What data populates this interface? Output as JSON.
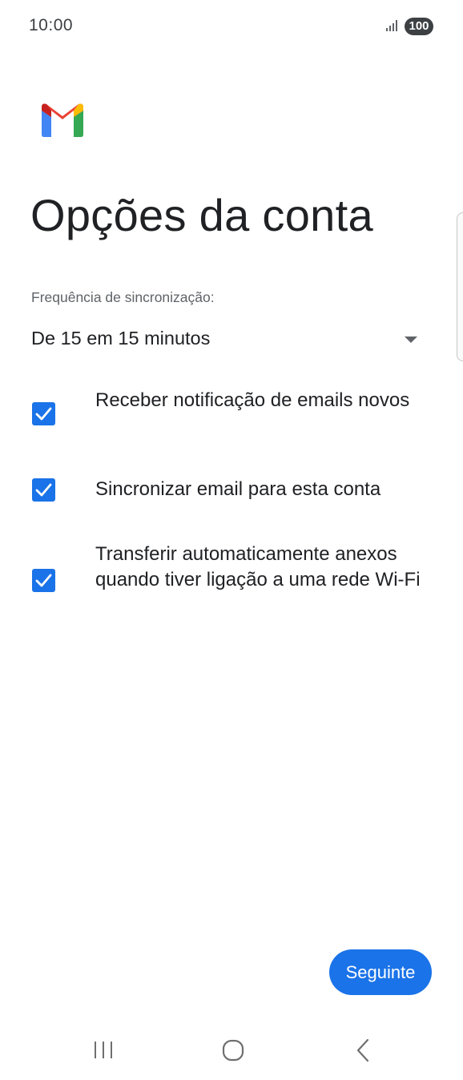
{
  "status_bar": {
    "time": "10:00",
    "signal_icon": "signal-bars-icon",
    "battery": "100"
  },
  "header": {
    "logo_icon": "gmail-logo-icon",
    "title": "Opções da conta"
  },
  "sync": {
    "label": "Frequência de sincronização:",
    "selected": "De 15 em 15 minutos",
    "dropdown_icon": "dropdown-arrow-icon"
  },
  "options": [
    {
      "label": "Receber notificação de emails novos",
      "checked": true
    },
    {
      "label": "Sincronizar email para esta conta",
      "checked": true
    },
    {
      "label": "Transferir automaticamente anexos quando tiver ligação a uma rede Wi-Fi",
      "checked": true
    }
  ],
  "actions": {
    "next_label": "Seguinte"
  },
  "nav_bar": {
    "items": [
      "recent-apps-icon",
      "home-icon",
      "back-icon"
    ]
  },
  "colors": {
    "accent": "#1a73e8",
    "text": "#202124",
    "secondary_text": "#5f6368",
    "gmail_red": "#ea4335",
    "gmail_blue": "#4285f4",
    "gmail_green": "#34a853",
    "gmail_yellow": "#fbbc04",
    "gmail_dark_red": "#c5221f"
  }
}
